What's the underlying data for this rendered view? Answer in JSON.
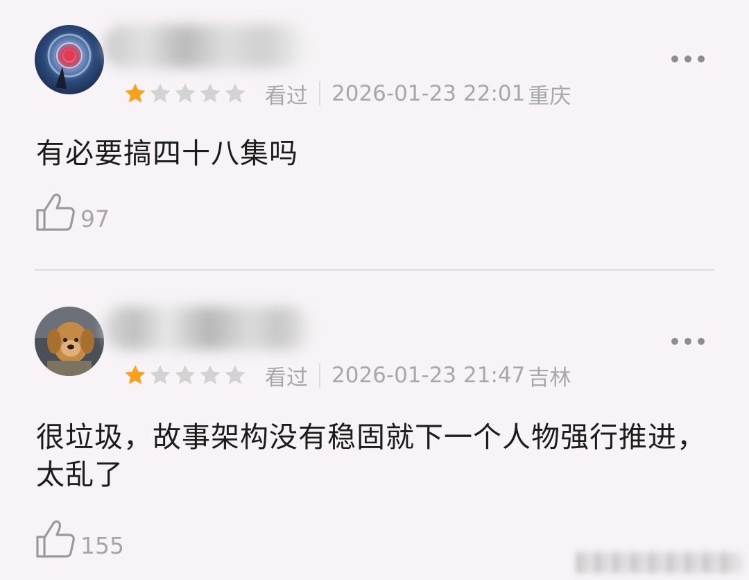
{
  "reviews": [
    {
      "rating": 1,
      "rating_max": 5,
      "status": "看过",
      "time": "2026-01-23 22:01",
      "location": "重庆",
      "content": "有必要搞四十八集吗",
      "likes": "97"
    },
    {
      "rating": 1,
      "rating_max": 5,
      "status": "看过",
      "time": "2026-01-23 21:47",
      "location": "吉林",
      "content": "很垃圾，故事架构没有稳固就下一个人物强行推进，太乱了",
      "likes": "155"
    }
  ],
  "colors": {
    "star_active": "#f7a11d",
    "star_inactive": "#d3d3d3",
    "meta_text": "#a8a8a8",
    "background": "#f7f3f6"
  },
  "icons": [
    "more-icon",
    "star-icon",
    "thumbs-up-icon"
  ]
}
